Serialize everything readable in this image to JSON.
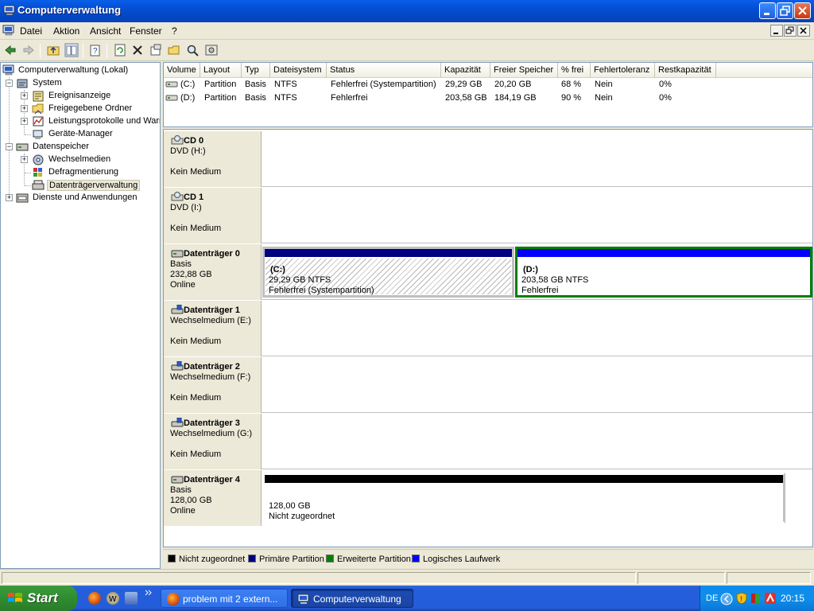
{
  "window": {
    "title": "Computerverwaltung"
  },
  "menu": {
    "items": [
      "Datei",
      "Aktion",
      "Ansicht",
      "Fenster",
      "?"
    ]
  },
  "tree": {
    "root": "Computerverwaltung (Lokal)",
    "system": "System",
    "system_children": [
      "Ereignisanzeige",
      "Freigegebene Ordner",
      "Leistungsprotokolle und Warn",
      "Geräte-Manager"
    ],
    "storage": "Datenspeicher",
    "storage_children": [
      "Wechselmedien",
      "Defragmentierung",
      "Datenträgerverwaltung"
    ],
    "services": "Dienste und Anwendungen"
  },
  "volume_list": {
    "headers": [
      "Volume",
      "Layout",
      "Typ",
      "Dateisystem",
      "Status",
      "Kapazität",
      "Freier Speicher",
      "% frei",
      "Fehlertoleranz",
      "Restkapazität"
    ],
    "rows": [
      [
        "(C:)",
        "Partition",
        "Basis",
        "NTFS",
        "Fehlerfrei (Systempartition)",
        "29,29 GB",
        "20,20 GB",
        "68 %",
        "Nein",
        "0%"
      ],
      [
        "(D:)",
        "Partition",
        "Basis",
        "NTFS",
        "Fehlerfrei",
        "203,58 GB",
        "184,19 GB",
        "90 %",
        "Nein",
        "0%"
      ]
    ]
  },
  "disks": [
    {
      "name": "CD 0",
      "l2": "DVD (H:)",
      "l3": "",
      "l4": "Kein Medium",
      "icon": "cdrom-icon"
    },
    {
      "name": "CD 1",
      "l2": "DVD (I:)",
      "l3": "",
      "l4": "Kein Medium",
      "icon": "cdrom-icon"
    },
    {
      "name": "Datenträger 0",
      "l2": "Basis",
      "l3": "232,88 GB",
      "l4": "Online",
      "icon": "harddisk-icon",
      "partitions": [
        {
          "label": "(C:)",
          "size": "29,29 GB NTFS",
          "status": "Fehlerfrei (Systempartition)"
        },
        {
          "label": "(D:)",
          "size": "203,58 GB NTFS",
          "status": "Fehlerfrei"
        }
      ]
    },
    {
      "name": "Datenträger 1",
      "l2": "Wechselmedium (E:)",
      "l3": "",
      "l4": "Kein Medium",
      "icon": "removable-disk-icon"
    },
    {
      "name": "Datenträger 2",
      "l2": "Wechselmedium (F:)",
      "l3": "",
      "l4": "Kein Medium",
      "icon": "removable-disk-icon"
    },
    {
      "name": "Datenträger 3",
      "l2": "Wechselmedium (G:)",
      "l3": "",
      "l4": "Kein Medium",
      "icon": "removable-disk-icon"
    },
    {
      "name": "Datenträger 4",
      "l2": "Basis",
      "l3": "128,00 GB",
      "l4": "Online",
      "icon": "harddisk-icon",
      "partitions": [
        {
          "label": "",
          "size": "128,00 GB",
          "status": "Nicht zugeordnet"
        }
      ]
    }
  ],
  "legend": [
    {
      "label": "Nicht zugeordnet",
      "color": "#000000"
    },
    {
      "label": "Primäre Partition",
      "color": "#000080"
    },
    {
      "label": "Erweiterte Partition",
      "color": "#008000"
    },
    {
      "label": "Logisches Laufwerk",
      "color": "#0000FF"
    }
  ],
  "taskbar": {
    "start": "Start",
    "tasks": [
      "problem mit 2 extern...",
      "Computerverwaltung"
    ],
    "lang": "DE",
    "clock": "20:15"
  },
  "colors": {
    "primary": "#000080",
    "logical": "#0000FF",
    "extended": "#008000",
    "unallocated": "#000000"
  }
}
